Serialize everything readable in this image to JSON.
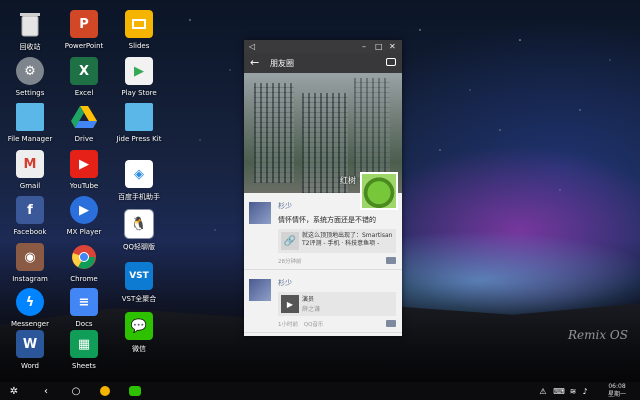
{
  "desktop": {
    "icons": [
      {
        "label": "回收站",
        "icon": "trash-icon",
        "color": "#dcdcdc"
      },
      {
        "label": "PowerPoint",
        "icon": "powerpoint-icon",
        "color": "#d24726"
      },
      {
        "label": "Slides",
        "icon": "slides-icon",
        "color": "#f4b400"
      },
      {
        "label": "Settings",
        "icon": "gear-icon",
        "color": "#8a8f96"
      },
      {
        "label": "Excel",
        "icon": "excel-icon",
        "color": "#1e7145"
      },
      {
        "label": "Play Store",
        "icon": "play-store-icon",
        "color": "#f2f2f2"
      },
      {
        "label": "File Manager",
        "icon": "folder-icon",
        "color": "#5bb7e8"
      },
      {
        "label": "Drive",
        "icon": "drive-icon",
        "color": "#1fa463"
      },
      {
        "label": "Jide Press Kit",
        "icon": "folder-icon",
        "color": "#5bb7e8"
      },
      {
        "label": "Gmail",
        "icon": "gmail-icon",
        "color": "#e8e8e8"
      },
      {
        "label": "YouTube",
        "icon": "youtube-icon",
        "color": "#e62117"
      },
      {
        "label": "百度手机助手",
        "icon": "baidu-assistant-icon",
        "color": "#2b8ae6"
      },
      {
        "label": "Facebook",
        "icon": "facebook-icon",
        "color": "#3b5998"
      },
      {
        "label": "MX Player",
        "icon": "mx-player-icon",
        "color": "#2a6fdb"
      },
      {
        "label": "QQ轻聊版",
        "icon": "qq-icon",
        "color": "#ffffff"
      },
      {
        "label": "Instagram",
        "icon": "instagram-icon",
        "color": "#8a5a44"
      },
      {
        "label": "Chrome",
        "icon": "chrome-icon",
        "color": "#db4437"
      },
      {
        "label": "VST全聚合",
        "icon": "vst-icon",
        "color": "#0c7bd1"
      },
      {
        "label": "Messenger",
        "icon": "messenger-icon",
        "color": "#0084ff"
      },
      {
        "label": "Docs",
        "icon": "docs-icon",
        "color": "#4285f4"
      },
      {
        "label": "微信",
        "icon": "wechat-icon",
        "color": "#2dc100"
      },
      {
        "label": "Word",
        "icon": "word-icon",
        "color": "#2b579a"
      },
      {
        "label": "Sheets",
        "icon": "sheets-icon",
        "color": "#0f9d58"
      }
    ],
    "watermark": "Remix OS"
  },
  "window": {
    "title": "朋友圈",
    "cover_name": "红树",
    "posts": [
      {
        "author": "杉少",
        "text": "情怀情怀，系统方面还是不错的",
        "link_title": "就这么顶顶地出现了：Smartisan T2评测 - 手机 · 科技意鱼项 -",
        "time": "28分钟前"
      },
      {
        "author": "杉少",
        "music_title": "演员",
        "music_artist": "薛之谦",
        "time": "1小时前",
        "source": "QQ音乐"
      }
    ]
  },
  "taskbar": {
    "time": "06:08",
    "day": "星期一"
  }
}
